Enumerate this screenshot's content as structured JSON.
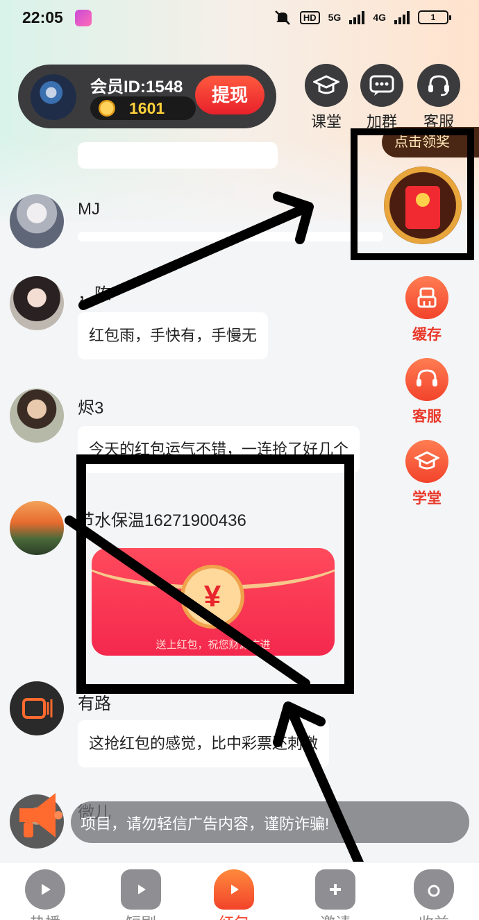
{
  "status_bar": {
    "time": "22:05",
    "network_badge": "HD",
    "signal_1_label": "5G",
    "signal_2_label": "4G",
    "battery": "1"
  },
  "member": {
    "id_text": "会员ID:1548",
    "coins": "1601",
    "withdraw_label": "提现"
  },
  "top_buttons": [
    {
      "label": "课堂",
      "icon": "graduation-cap-icon"
    },
    {
      "label": "加群",
      "icon": "chat-bubble-icon"
    },
    {
      "label": "客服",
      "icon": "headset-icon"
    }
  ],
  "floating_redpacket": {
    "tip": "点击领奖"
  },
  "side_buttons": [
    {
      "label": "缓存",
      "icon": "broom-icon"
    },
    {
      "label": "客服",
      "icon": "headset-icon"
    },
    {
      "label": "学堂",
      "icon": "graduation-cap-icon"
    }
  ],
  "feed": [
    {
      "name": "MJ",
      "message": ""
    },
    {
      "name": "，陈",
      "message": "红包雨，手快有，手慢无"
    },
    {
      "name": "烬3",
      "message": "今天的红包运气不错，一连抢了好几个"
    },
    {
      "name": "节水保温16271900436",
      "message": ""
    },
    {
      "name": "有路",
      "message": "这抢红包的感觉，比中彩票还刺激"
    },
    {
      "name": "微儿",
      "message": ""
    }
  ],
  "red_packet_card": {
    "symbol": "¥",
    "text": "送上红包，祝您财源广进"
  },
  "notice": {
    "text": "项目，请勿轻信广告内容，谨防诈骗!"
  },
  "bottom_nav": [
    {
      "label": "热播",
      "active": false
    },
    {
      "label": "短剧",
      "active": false
    },
    {
      "label": "红包",
      "active": true
    },
    {
      "label": "邀请",
      "active": false
    },
    {
      "label": "收益",
      "active": false
    }
  ],
  "colors": {
    "accent_red": "#f2432b",
    "pill_dark": "#3b3b3d",
    "coin_gold": "#ffd23a"
  }
}
